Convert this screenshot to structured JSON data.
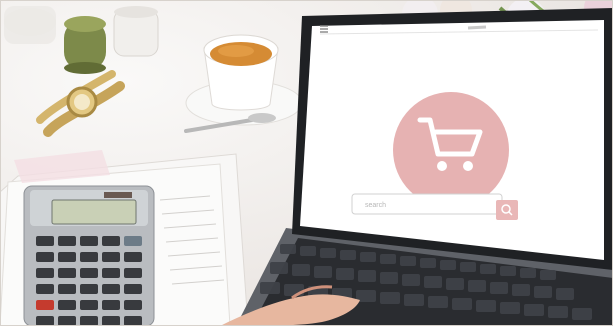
{
  "screen": {
    "search": {
      "placeholder": "search"
    },
    "accent": "#e7b0b0",
    "accent_dark": "#d98d8f"
  },
  "icons": {
    "cart": "shopping-cart-icon",
    "search": "magnifier-icon",
    "menu": "menu-icon"
  }
}
